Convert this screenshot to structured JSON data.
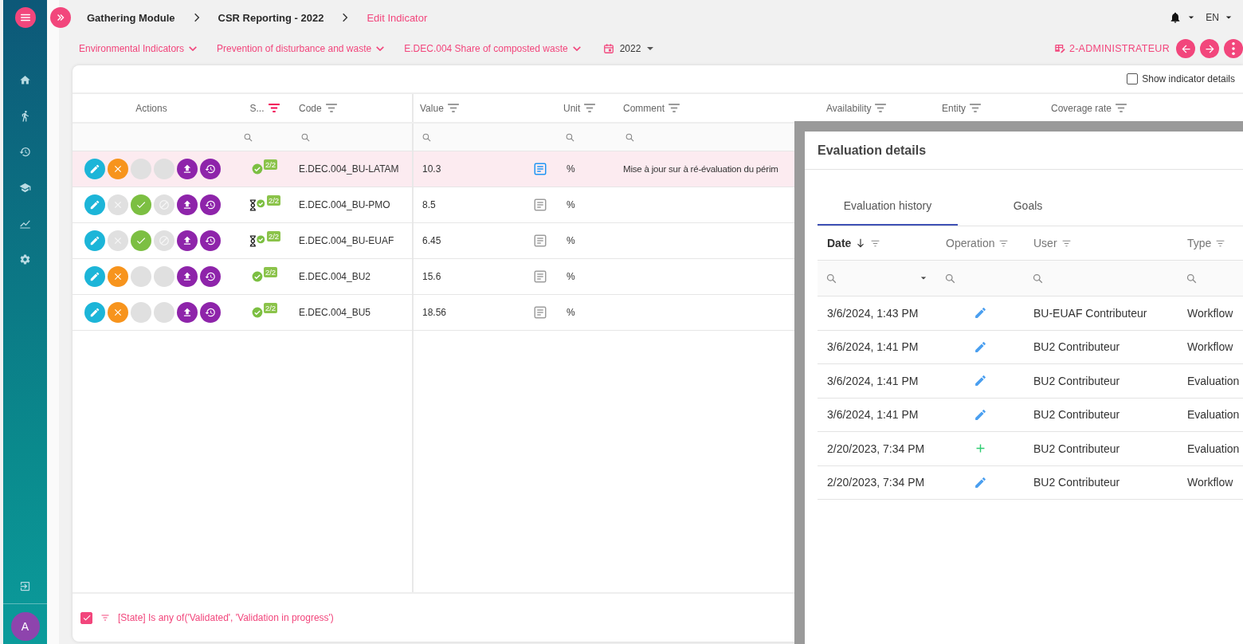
{
  "sidebar": {
    "items": [
      {
        "kind": "home"
      },
      {
        "kind": "walk"
      },
      {
        "kind": "history"
      },
      {
        "kind": "school"
      },
      {
        "kind": "chart"
      },
      {
        "kind": "settings"
      }
    ],
    "bottom_items": [
      {
        "kind": "logout"
      }
    ],
    "avatar": "A"
  },
  "breadcrumb": [
    {
      "label": "Gathering Module",
      "current": false
    },
    {
      "label": "CSR Reporting - 2022",
      "current": false
    },
    {
      "label": "Edit Indicator",
      "current": true
    }
  ],
  "language": "EN",
  "filters": [
    {
      "label": "Environmental Indicators"
    },
    {
      "label": "Prevention of disturbance and waste"
    },
    {
      "label": "E.DEC.004 Share of composted waste"
    }
  ],
  "year": "2022",
  "role": "2-ADMINISTRATEUR",
  "show_details": {
    "label": "Show indicator details",
    "checked": false
  },
  "table": {
    "columns": [
      {
        "label": "Actions",
        "filterable": false,
        "searchable": false
      },
      {
        "label": "S...",
        "filterable": true,
        "filtered": true,
        "searchable": true
      },
      {
        "label": "Code",
        "filterable": true,
        "filtered": false,
        "searchable": true
      },
      {
        "label": "Value",
        "filterable": true,
        "filtered": false,
        "searchable": true
      },
      {
        "label": "Unit",
        "filterable": true,
        "filtered": false,
        "searchable": true
      },
      {
        "label": "Comment",
        "filterable": true,
        "filtered": false,
        "searchable": true
      },
      {
        "label": "Availability",
        "filterable": true,
        "filtered": false
      },
      {
        "label": "Entity",
        "filterable": true,
        "filtered": false
      },
      {
        "label": "Coverage rate",
        "filterable": true,
        "filtered": false
      }
    ],
    "rows": [
      {
        "selected": true,
        "actions": [
          {
            "kind": "edit",
            "disabled": false,
            "blank": false
          },
          {
            "kind": "reject",
            "disabled": false,
            "blank": false
          },
          {
            "kind": "validate",
            "disabled": true,
            "blank": true
          },
          {
            "kind": "cancel",
            "disabled": true,
            "blank": true
          },
          {
            "kind": "upload",
            "disabled": false,
            "blank": false
          },
          {
            "kind": "history",
            "disabled": false,
            "blank": false
          }
        ],
        "in_progress": false,
        "badge": "2/2",
        "code": "E.DEC.004_BU-LATAM",
        "value": "10.3",
        "note_highlighted": true,
        "unit": "%",
        "comment": "Mise à jour sur à ré-évaluation du périm"
      },
      {
        "selected": false,
        "actions": [
          {
            "kind": "edit",
            "disabled": false,
            "blank": false
          },
          {
            "kind": "reject",
            "disabled": true,
            "blank": false
          },
          {
            "kind": "validate",
            "disabled": false,
            "blank": false
          },
          {
            "kind": "cancel",
            "disabled": true,
            "blank": false
          },
          {
            "kind": "upload",
            "disabled": false,
            "blank": false
          },
          {
            "kind": "history",
            "disabled": false,
            "blank": false
          }
        ],
        "in_progress": true,
        "badge": "2/2",
        "code": "E.DEC.004_BU-PMO",
        "value": "8.5",
        "note_highlighted": false,
        "unit": "%"
      },
      {
        "selected": false,
        "actions": [
          {
            "kind": "edit",
            "disabled": false,
            "blank": false
          },
          {
            "kind": "reject",
            "disabled": true,
            "blank": false
          },
          {
            "kind": "validate",
            "disabled": false,
            "blank": false
          },
          {
            "kind": "cancel",
            "disabled": true,
            "blank": false
          },
          {
            "kind": "upload",
            "disabled": false,
            "blank": false
          },
          {
            "kind": "history",
            "disabled": false,
            "blank": false
          }
        ],
        "in_progress": true,
        "badge": "2/2",
        "code": "E.DEC.004_BU-EUAF",
        "value": "6.45",
        "note_highlighted": false,
        "unit": "%"
      },
      {
        "selected": false,
        "actions": [
          {
            "kind": "edit",
            "disabled": false,
            "blank": false
          },
          {
            "kind": "reject",
            "disabled": false,
            "blank": false
          },
          {
            "kind": "validate",
            "disabled": true,
            "blank": true
          },
          {
            "kind": "cancel",
            "disabled": true,
            "blank": true
          },
          {
            "kind": "upload",
            "disabled": false,
            "blank": false
          },
          {
            "kind": "history",
            "disabled": false,
            "blank": false
          }
        ],
        "in_progress": false,
        "badge": "2/2",
        "code": "E.DEC.004_BU2",
        "value": "15.6",
        "note_highlighted": false,
        "unit": "%"
      },
      {
        "selected": false,
        "actions": [
          {
            "kind": "edit",
            "disabled": false,
            "blank": false
          },
          {
            "kind": "reject",
            "disabled": false,
            "blank": false
          },
          {
            "kind": "validate",
            "disabled": true,
            "blank": true
          },
          {
            "kind": "cancel",
            "disabled": true,
            "blank": true
          },
          {
            "kind": "upload",
            "disabled": false,
            "blank": false
          },
          {
            "kind": "history",
            "disabled": false,
            "blank": false
          }
        ],
        "in_progress": false,
        "badge": "2/2",
        "code": "E.DEC.004_BU5",
        "value": "18.56",
        "note_highlighted": false,
        "unit": "%"
      }
    ]
  },
  "footer_filter": {
    "checked": true,
    "text": "[State] Is any of('Validated', 'Validation in progress')"
  },
  "dialog": {
    "title": "Evaluation details",
    "tabs": [
      {
        "label": "Evaluation history",
        "selected": true
      },
      {
        "label": "Goals",
        "selected": false
      }
    ],
    "columns": [
      {
        "label": "Date",
        "sorted": true,
        "dropdown": true
      },
      {
        "label": "Operation",
        "sorted": false,
        "dropdown": false
      },
      {
        "label": "User",
        "sorted": false,
        "dropdown": false
      },
      {
        "label": "Type",
        "sorted": false,
        "dropdown": false
      }
    ],
    "rows": [
      {
        "date": "3/6/2024, 1:43 PM",
        "kind": "edit",
        "user": "BU-EUAF Contributeur",
        "type": "Workflow"
      },
      {
        "date": "3/6/2024, 1:41 PM",
        "kind": "edit",
        "user": "BU2 Contributeur",
        "type": "Workflow"
      },
      {
        "date": "3/6/2024, 1:41 PM",
        "kind": "edit",
        "user": "BU2 Contributeur",
        "type": "Evaluation"
      },
      {
        "date": "3/6/2024, 1:41 PM",
        "kind": "edit",
        "user": "BU2 Contributeur",
        "type": "Evaluation"
      },
      {
        "date": "2/20/2023, 7:34 PM",
        "kind": "add",
        "user": "BU2 Contributeur",
        "type": "Evaluation"
      },
      {
        "date": "2/20/2023, 7:34 PM",
        "kind": "edit",
        "user": "BU2 Contributeur",
        "type": "Workflow"
      }
    ]
  }
}
